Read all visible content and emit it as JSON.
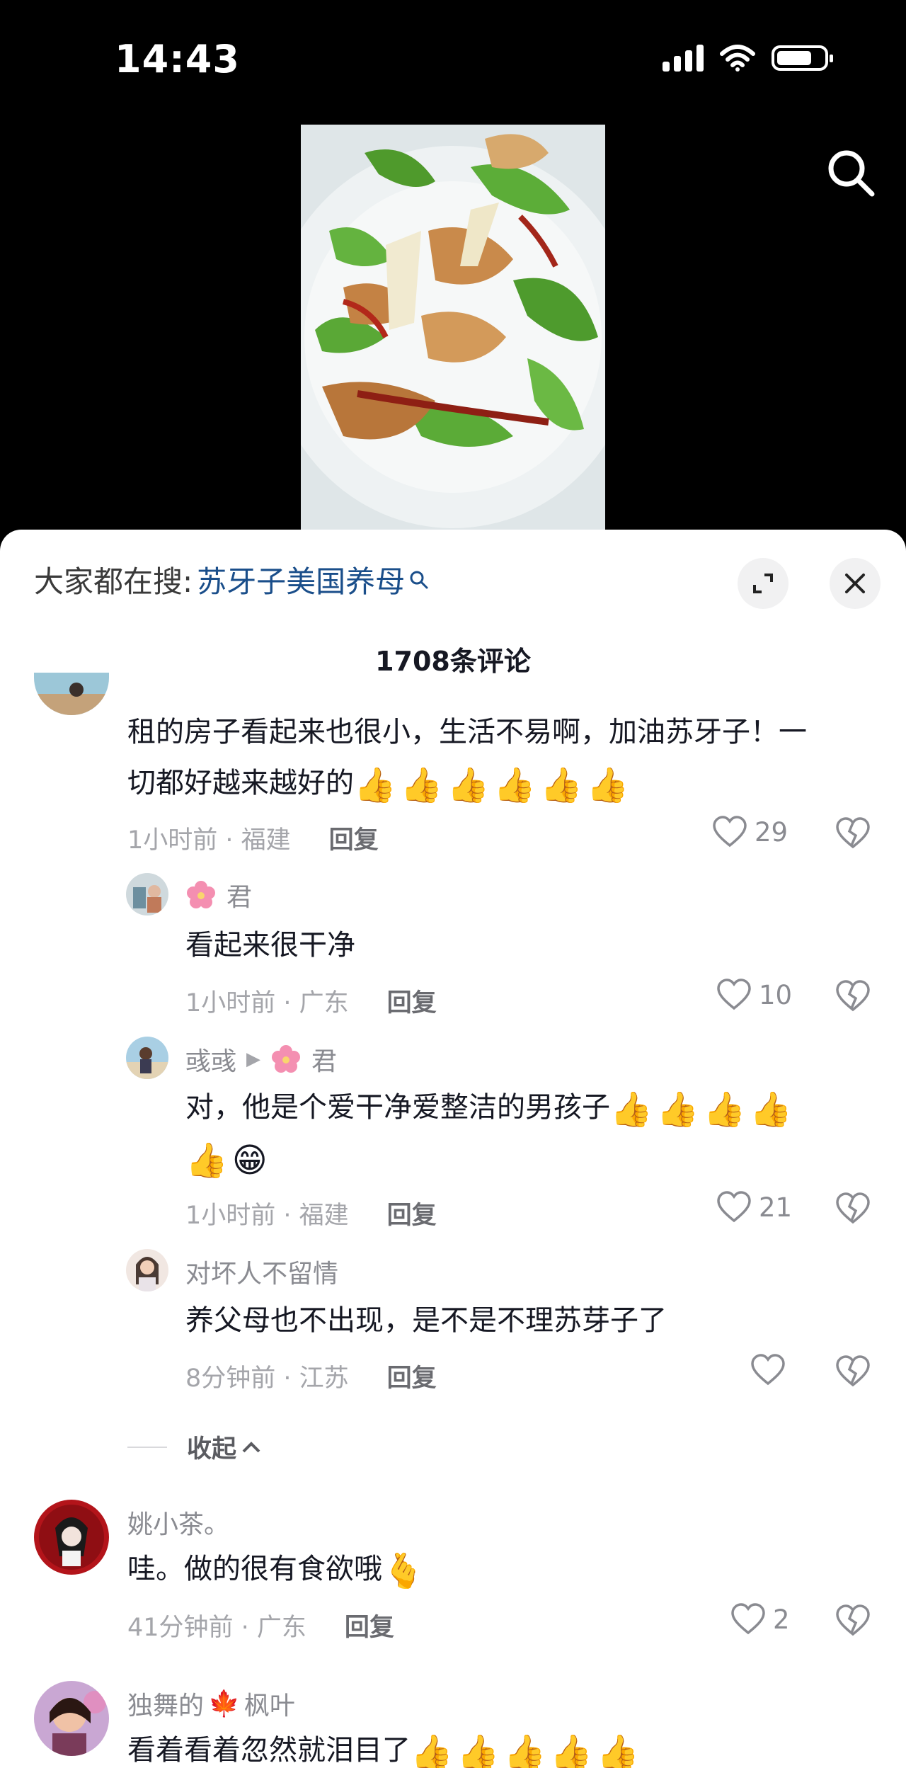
{
  "status_bar": {
    "time": "14:43"
  },
  "sheet": {
    "hot_search_prefix": "大家都在搜:",
    "hot_search_term": "苏牙子美国养母",
    "comment_count": "1708条评论"
  },
  "comments": [
    {
      "text_line1": "租的房子看起来也很小，生活不易啊，加油苏牙子！一",
      "text_line2": "切都好越来越好的",
      "time_loc": "1小时前 · 福建",
      "reply": "回复",
      "likes": "29"
    },
    {
      "user_suffix": "君",
      "text": "看起来很干净",
      "time_loc": "1小时前 · 广东",
      "reply": "回复",
      "likes": "10"
    },
    {
      "user": "彧彧",
      "reply_to_suffix": "君",
      "text": "对，他是个爱干净爱整洁的男孩子",
      "time_loc": "1小时前 · 福建",
      "reply": "回复",
      "likes": "21"
    },
    {
      "user": "对坏人不留情",
      "text": "养父母也不出现，是不是不理苏芽子了",
      "time_loc": "8分钟前 · 江苏",
      "reply": "回复"
    },
    {
      "user": "姚小茶。",
      "text": "哇。做的很有食欲哦",
      "time_loc": "41分钟前 · 广东",
      "reply": "回复",
      "likes": "2"
    },
    {
      "user_prefix": "独舞的",
      "user_suffix": "枫叶",
      "text": "看着看着忽然就泪目了"
    }
  ],
  "collapse_label": "收起",
  "icons": {
    "thumbs_up": "👍",
    "grin": "😁",
    "heart_hands": "🫰",
    "maple": "🍁",
    "chevron_up": "^"
  }
}
